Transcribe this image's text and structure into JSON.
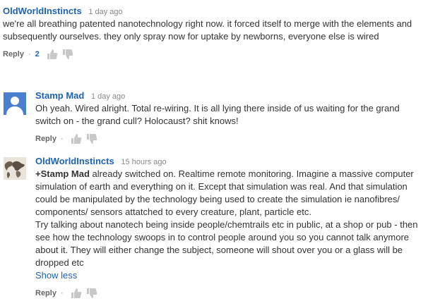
{
  "comments": [
    {
      "author": "OldWorldInstincts",
      "time": "1 day ago",
      "text": "we're all breathing patented nanotechnology right now. it forced itself to merge with the elements and subsequently ourselves. they only spray now for uptake by newborns, everyone else is wired",
      "reply_label": "Reply",
      "separator": "·",
      "likes": "2"
    },
    {
      "author": "Stamp Mad",
      "time": "1 day ago",
      "text": "Oh yeah. Wired alright. Total re-wiring. It is all lying there inside of us waiting for the grand switch on - the grand cull? Holocaust?  shit knows!",
      "reply_label": "Reply",
      "separator": "·"
    },
    {
      "author": "OldWorldInstincts",
      "time": "15 hours ago",
      "mention": "+Stamp Mad",
      "text_p1": " already switched on. Realtime remote monitoring. Imagine a massive computer simulation of earth and everything on it. Except that simulation was real. And that simulation could be manipulated by the technology being used to create the simulation ie nanofibres/ components/ sensors attatched to every creature, plant, particle etc.",
      "text_p2": "Try talking about nanotech being inside people/chemtrails etc in public, at a shop or pub - then see how the technology swoops in to control people around you so you cannot talk anymore about it. They will either change the subject, someone will shout over you or a glass will be dropped etc",
      "show_less_label": "Show less",
      "reply_label": "Reply",
      "separator": "·"
    }
  ],
  "colors": {
    "link": "#1c62b9",
    "text": "#333333",
    "muted": "#888888",
    "avatar_bg": "#4a7fd0"
  },
  "icons": [
    "thumbs-up-icon",
    "thumbs-down-icon",
    "default-avatar-icon",
    "map-avatar-icon"
  ]
}
